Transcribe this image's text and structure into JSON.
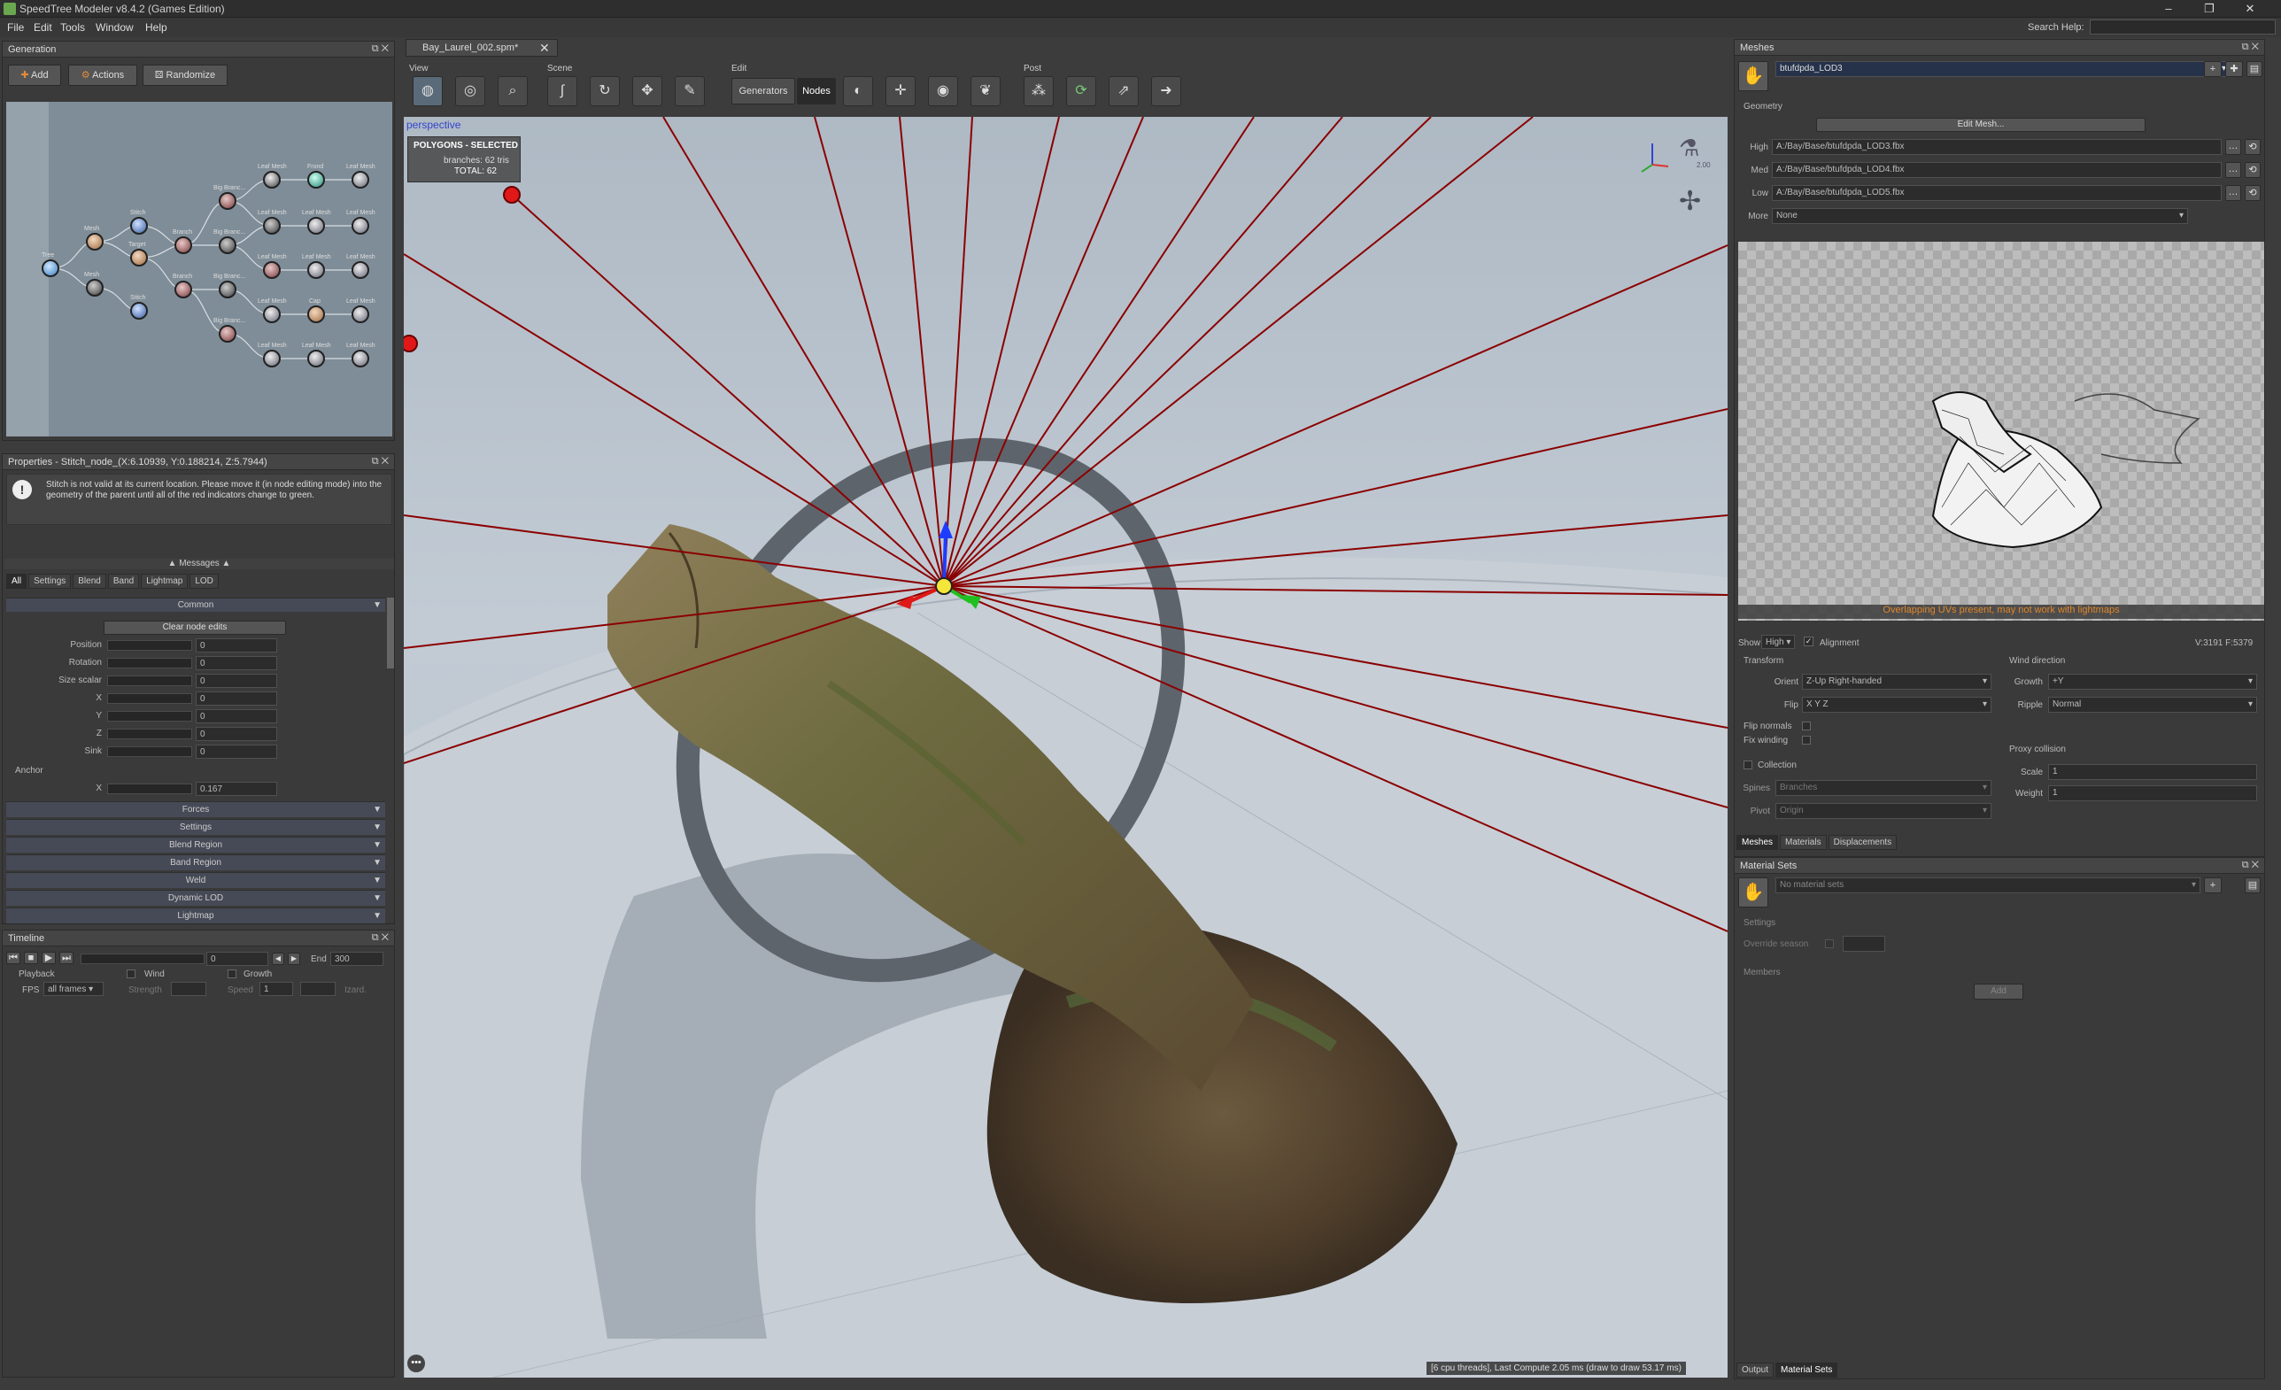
{
  "window": {
    "title": "SpeedTree Modeler v8.4.2 (Games Edition)",
    "min": "–",
    "max": "❐",
    "close": "✕"
  },
  "menu": [
    "File",
    "Edit",
    "Tools",
    "Window",
    "Help"
  ],
  "search_help_label": "Search Help:",
  "generation": {
    "title": "Generation",
    "buttons": {
      "add": "Add",
      "actions": "Actions",
      "randomize": "Randomize"
    },
    "nodes": [
      "Tree",
      "Mesh",
      "Mesh",
      "Stitch",
      "Target",
      "Stitch",
      "Branch",
      "Branch",
      "Big Branc...",
      "Big Branc...",
      "Big Branc...",
      "Big Branc...",
      "Leaf Mesh",
      "Frond",
      "Leaf Mesh",
      "Leaf Mesh",
      "Leaf Mesh",
      "Leaf Mesh",
      "Leaf Mesh",
      "Leaf Mesh",
      "Cap",
      "Leaf Mesh",
      "Leaf Mesh",
      "Leaf Mesh",
      "Leaf Mesh",
      "Leaf Mesh"
    ]
  },
  "properties": {
    "title": "Properties - Stitch_node_(X:6.10939, Y:0.188214, Z:5.7944)",
    "message": "Stitch is not valid at its current location.  Please move it (in node editing mode) into the geometry of the parent until all of the red indicators change to green.",
    "messages_label": "Messages",
    "tabs": [
      "All",
      "Settings",
      "Blend",
      "Band",
      "Lightmap",
      "LOD"
    ],
    "common_section": "Common",
    "clear_button": "Clear node edits",
    "fields": [
      {
        "label": "Position",
        "value": "0"
      },
      {
        "label": "Rotation",
        "value": "0"
      },
      {
        "label": "Size scalar",
        "value": "0"
      },
      {
        "label": "X",
        "value": "0"
      },
      {
        "label": "Y",
        "value": "0"
      },
      {
        "label": "Z",
        "value": "0"
      },
      {
        "label": "Sink",
        "value": "0"
      }
    ],
    "anchor_label": "Anchor",
    "anchor_x": {
      "label": "X",
      "value": "0.167"
    },
    "sections": [
      "Forces",
      "Settings",
      "Blend Region",
      "Band Region",
      "Weld",
      "Dynamic LOD",
      "Lightmap"
    ]
  },
  "timeline": {
    "title": "Timeline",
    "start_value": "0",
    "end_label": "End",
    "end_value": "300",
    "playback_label": "Playback",
    "wind_label": "Wind",
    "growth_label": "Growth",
    "fps_label": "FPS",
    "fps_value": "all frames",
    "strength_label": "Strength",
    "speed_label": "Speed",
    "speed_value": "1",
    "interp_label": "Izard."
  },
  "document_tab": "Bay_Laurel_002.spm*",
  "toolbar": {
    "groups": {
      "view": "View",
      "scene": "Scene",
      "edit": "Edit",
      "post": "Post"
    },
    "generators": "Generators",
    "nodes": "Nodes"
  },
  "viewport": {
    "label": "perspective",
    "selection_title": "POLYGONS - SELECTED",
    "branches_line": "branches:  62 tris",
    "total_line": "TOTAL:  62",
    "status": "[6 cpu threads], Last Compute 2.05 ms (draw to draw 53.17 ms)",
    "scale_text": "2.00"
  },
  "meshes": {
    "title": "Meshes",
    "selected_mesh": "btufdpda_LOD3",
    "geometry_label": "Geometry",
    "edit_mesh": "Edit Mesh...",
    "lods": [
      {
        "label": "High",
        "value": "A:/Bay/Base/btufdpda_LOD3.fbx"
      },
      {
        "label": "Med",
        "value": "A:/Bay/Base/btufdpda_LOD4.fbx"
      },
      {
        "label": "Low",
        "value": "A:/Bay/Base/btufdpda_LOD5.fbx"
      },
      {
        "label": "More",
        "value": "None"
      }
    ],
    "warning": "Overlapping UVs present, may not work with lightmaps",
    "show_label": "Show",
    "show_value": "High",
    "alignment_label": "Alignment",
    "stats": "V:3191  F:5379",
    "transform_label": "Transform",
    "orient_label": "Orient",
    "orient_value": "Z-Up Right-handed",
    "flip_label": "Flip",
    "flip_value": "X Y Z",
    "flip_normals": "Flip normals",
    "fix_winding": "Fix winding",
    "collection_label": "Collection",
    "spines_label": "Spines",
    "spines_value": "Branches",
    "pivot_label": "Pivot",
    "pivot_value": "Origin",
    "wind_direction_label": "Wind direction",
    "growth_label": "Growth",
    "growth_value": "+Y",
    "ripple_label": "Ripple",
    "ripple_value": "Normal",
    "proxy_label": "Proxy collision",
    "scale_label": "Scale",
    "scale_value": "1",
    "weight_label": "Weight",
    "weight_value": "1",
    "tabs": [
      "Meshes",
      "Materials",
      "Displacements"
    ]
  },
  "material_sets": {
    "title": "Material Sets",
    "selected": "No material sets",
    "settings_label": "Settings",
    "override_label": "Override season",
    "members_label": "Members",
    "add_button": "Add",
    "bottom_tabs": [
      "Output",
      "Material Sets"
    ]
  },
  "colors": {
    "accent_blue": "#3344cc",
    "warning": "#e0862a",
    "ring": "#5e646c",
    "ray": "#8b0000"
  }
}
